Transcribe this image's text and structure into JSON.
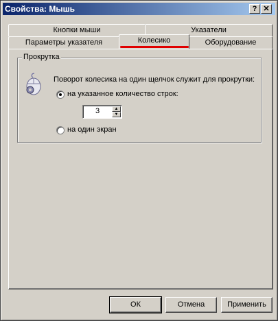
{
  "window": {
    "title": "Свойства: Мышь",
    "help_button": "?",
    "close_button": "✕"
  },
  "tabs": {
    "row_back": [
      "Кнопки мыши",
      "Указатели"
    ],
    "row_front": [
      "Параметры указателя",
      "Колесико",
      "Оборудование"
    ],
    "active": "Колесико"
  },
  "scroll_group": {
    "legend": "Прокрутка",
    "description": "Поворот колесика на один щелчок служит для прокрутки:",
    "option_lines": "на указанное количество строк:",
    "lines_value": "3",
    "option_screen": "на один экран",
    "selected_option": "lines"
  },
  "buttons": {
    "ok": "ОК",
    "cancel": "Отмена",
    "apply": "Применить"
  },
  "colors": {
    "titlebar_start": "#0a246a",
    "titlebar_end": "#a6caf0",
    "highlight_underline": "#e00000"
  }
}
